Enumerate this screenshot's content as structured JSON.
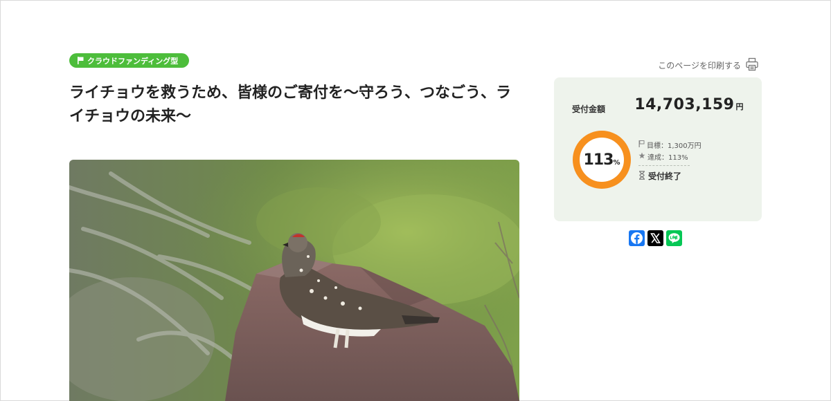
{
  "badge": {
    "label": "クラウドファンディング型",
    "icon": "flag-icon",
    "color": "#4dbd3b"
  },
  "title": "ライチョウを救うため、皆様のご寄付を～守ろう、つなごう、ライチョウの未来～",
  "print": {
    "label": "このページを印刷する",
    "icon": "printer-icon"
  },
  "funding": {
    "amount_label": "受付金額",
    "amount": "14,703,159",
    "amount_unit": "円",
    "progress_percent": 113,
    "progress_number": "113",
    "progress_unit": "%",
    "ring_color": "#f7901e",
    "goal_text": "目標：1,300万円",
    "achieved_text": "達成：113%",
    "status_text": "受付終了"
  },
  "share": {
    "buttons": [
      {
        "icon": "facebook-icon",
        "color": "#1877f2"
      },
      {
        "icon": "x-icon",
        "color": "#000000"
      },
      {
        "icon": "line-icon",
        "color": "#06c755"
      }
    ]
  }
}
